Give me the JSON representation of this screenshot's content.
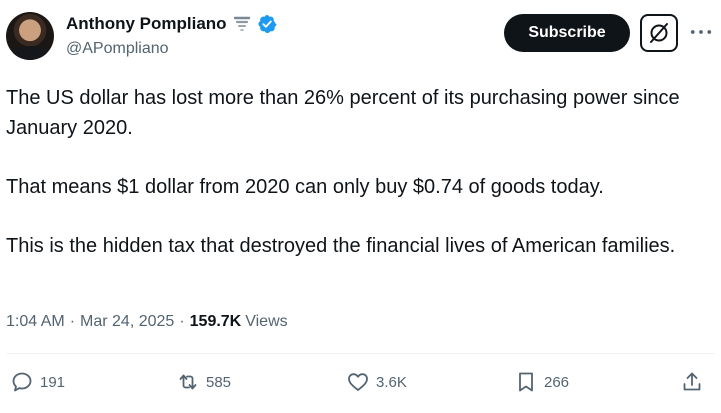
{
  "author": {
    "display_name": "Anthony Pompliano",
    "handle": "@APompliano",
    "emoji_icon": "tornado-icon",
    "verified_color": "#1d9bf0"
  },
  "header": {
    "subscribe_label": "Subscribe"
  },
  "tweet": {
    "paragraphs": [
      "The US dollar has lost more than 26% percent of its purchasing power since January 2020.",
      "That means $1 dollar from 2020 can only buy $0.74 of goods today.",
      "This is the hidden tax that destroyed the financial lives of American families."
    ],
    "time": "1:04 AM",
    "date": "Mar 24, 2025",
    "separator": "·",
    "views_count": "159.7K",
    "views_label": "Views"
  },
  "actions": {
    "replies": "191",
    "reposts": "585",
    "likes": "3.6K",
    "bookmarks": "266"
  },
  "colors": {
    "text": "#0f1419",
    "muted": "#536471",
    "divider": "#eff3f4"
  }
}
